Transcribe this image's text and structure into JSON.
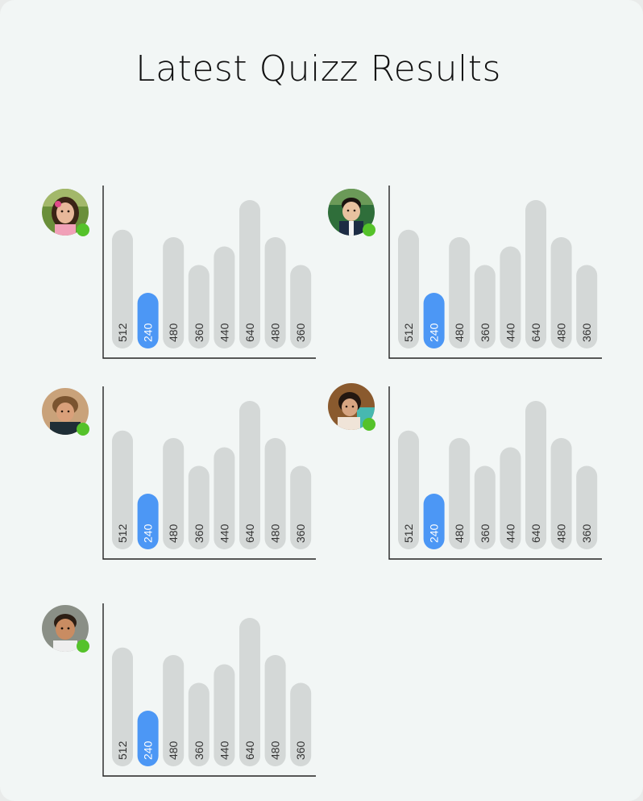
{
  "header": {
    "title": "Latest Quizz Results"
  },
  "colors": {
    "bar": "#d4d8d7",
    "highlight": "#4c97f5",
    "online": "#55c22a"
  },
  "chart_data": [
    {
      "type": "bar",
      "categories": [
        "",
        "",
        "",
        "",
        "",
        "",
        "",
        ""
      ],
      "values": [
        512,
        240,
        480,
        360,
        440,
        640,
        480,
        360
      ],
      "highlight_index": 1,
      "ylim": [
        0,
        640
      ],
      "grid": false
    },
    {
      "type": "bar",
      "categories": [
        "",
        "",
        "",
        "",
        "",
        "",
        "",
        ""
      ],
      "values": [
        512,
        240,
        480,
        360,
        440,
        640,
        480,
        360
      ],
      "highlight_index": 1,
      "ylim": [
        0,
        640
      ],
      "grid": false
    },
    {
      "type": "bar",
      "categories": [
        "",
        "",
        "",
        "",
        "",
        "",
        "",
        ""
      ],
      "values": [
        512,
        240,
        480,
        360,
        440,
        640,
        480,
        360
      ],
      "highlight_index": 1,
      "ylim": [
        0,
        640
      ],
      "grid": false
    },
    {
      "type": "bar",
      "categories": [
        "",
        "",
        "",
        "",
        "",
        "",
        "",
        ""
      ],
      "values": [
        512,
        240,
        480,
        360,
        440,
        640,
        480,
        360
      ],
      "highlight_index": 1,
      "ylim": [
        0,
        640
      ],
      "grid": false
    },
    {
      "type": "bar",
      "categories": [
        "",
        "",
        "",
        "",
        "",
        "",
        "",
        ""
      ],
      "values": [
        512,
        240,
        480,
        360,
        440,
        640,
        480,
        360
      ],
      "highlight_index": 1,
      "ylim": [
        0,
        640
      ],
      "grid": false
    }
  ],
  "students": [
    {
      "avatar": "student-avatar-girl-icon",
      "status": "online"
    },
    {
      "avatar": "student-avatar-boy-icon",
      "status": "online"
    },
    {
      "avatar": "student-avatar-boy-curly-icon",
      "status": "online"
    },
    {
      "avatar": "student-avatar-girl-smiling-icon",
      "status": "online"
    },
    {
      "avatar": "student-avatar-child-icon",
      "status": "online"
    }
  ]
}
